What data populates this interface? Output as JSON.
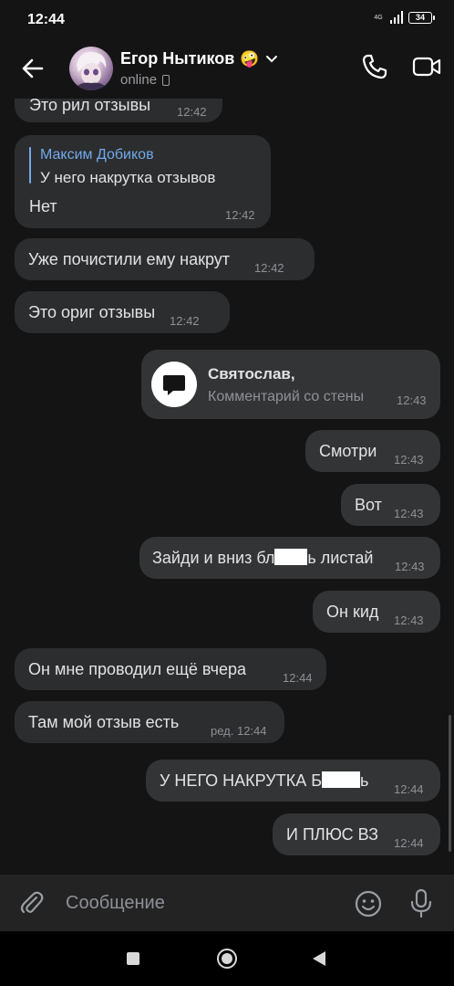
{
  "status_bar": {
    "time": "12:44",
    "network": "4G",
    "battery": "34"
  },
  "header": {
    "contact_name": "Егор Нытиков",
    "name_emoji": "🤪",
    "status": "online",
    "icons": [
      "back-arrow-icon",
      "chevron-down-icon",
      "phone-call-icon",
      "video-call-icon"
    ]
  },
  "messages": [
    {
      "dir": "in",
      "text": "Это рил отзывы",
      "time": "12:42"
    },
    {
      "dir": "in",
      "reply_author": "Максим Добиков",
      "reply_text": "У него накрутка отзывов",
      "text": "Нет",
      "time": "12:42"
    },
    {
      "dir": "in",
      "text": "Уже почистили ему накрут",
      "time": "12:42"
    },
    {
      "dir": "in",
      "text": "Это ориг отзывы",
      "time": "12:42"
    },
    {
      "dir": "out",
      "wall_title": "Святослав,",
      "wall_sub": "Комментарий со стены",
      "time": "12:43"
    },
    {
      "dir": "out",
      "text": "Смотри",
      "time": "12:43"
    },
    {
      "dir": "out",
      "text": "Вот",
      "time": "12:43"
    },
    {
      "dir": "out",
      "text_pre": "Зайди и вниз бл",
      "text_post": "ь листай",
      "time": "12:43"
    },
    {
      "dir": "out",
      "text": "Он кид",
      "time": "12:43"
    },
    {
      "dir": "in",
      "text": "Он мне проводил ещё вчера",
      "time": "12:44"
    },
    {
      "dir": "in",
      "text": "Там мой отзыв есть",
      "time": "ред. 12:44"
    },
    {
      "dir": "out",
      "text_pre": "У НЕГО НАКРУТКА Б",
      "text_post": "ь",
      "time": "12:44"
    },
    {
      "dir": "out",
      "text": "И ПЛЮС ВЗ",
      "time": "12:44"
    }
  ],
  "composer": {
    "placeholder": "Сообщение"
  },
  "colors": {
    "background": "#141414",
    "bubble_in": "#2c2d2e",
    "bubble_out": "#333435",
    "accent": "#71aaeb"
  }
}
